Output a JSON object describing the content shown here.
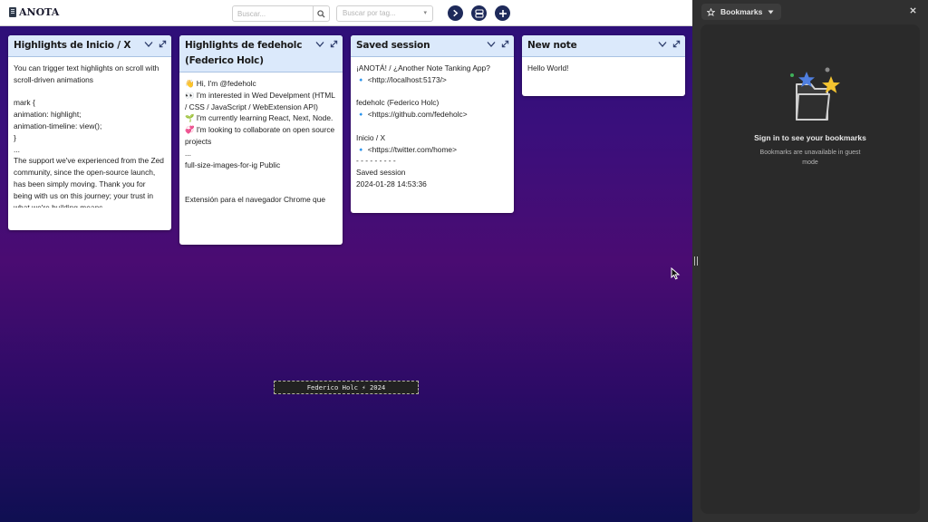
{
  "app": {
    "brand": "ANOTA",
    "search": {
      "placeholder": "Buscar..."
    },
    "tag_filter": {
      "placeholder": "Buscar por tag..."
    },
    "footer": "Federico Holc ⚡ 2024",
    "colors": {
      "header_bar": "#dbe9fb",
      "action_buttons": "#1e2a5a",
      "bg_top": "#2b0f78",
      "bg_bottom": "#0f0f52"
    }
  },
  "toolbar": {
    "buttons": [
      {
        "icon": "chevron-right-icon"
      },
      {
        "icon": "database-icon"
      },
      {
        "icon": "plus-icon"
      }
    ]
  },
  "notes": [
    {
      "title": "Highlights de Inicio / X",
      "body": "You can trigger text highlights on scroll with scroll-driven animations\n\nmark {\nanimation: highlight;\nanimation-timeline: view();\n}\n...\nThe support we've experienced from the Zed community, since the open-source launch, has been simply moving. Thank you for being with us on this journey; your trust in what we're building means"
    },
    {
      "title": "Highlights de fedeholc (Federico Holc)",
      "body": "👋 Hi, I'm @fedeholc\n👀 I'm interested in Wed Develpment (HTML / CSS / JavaScript / WebExtension API)\n🌱 I'm currently learning React, Next, Node.\n💞️ I'm looking to collaborate on open source projects\n...\nfull-size-images-for-ig Public\n\n\nExtensión para el navegador Chrome que"
    },
    {
      "title": "Saved session",
      "body": "¡ANOTÁ! / ¿Another Note Tanking App?\n🔹 <http://localhost:5173/>\n\nfedeholc (Federico Holc)\n🔹 <https://github.com/fedeholc>\n\nInicio / X\n🔹 <https://twitter.com/home>\n- - - - - - - - -\nSaved session\n2024-01-28 14:53:36"
    },
    {
      "title": "New note",
      "body": "Hello World!"
    }
  ],
  "side_panel": {
    "dropdown_label": "Bookmarks",
    "title": "Sign in to see your bookmarks",
    "subtitle": "Bookmarks are unavailable in guest mode"
  }
}
